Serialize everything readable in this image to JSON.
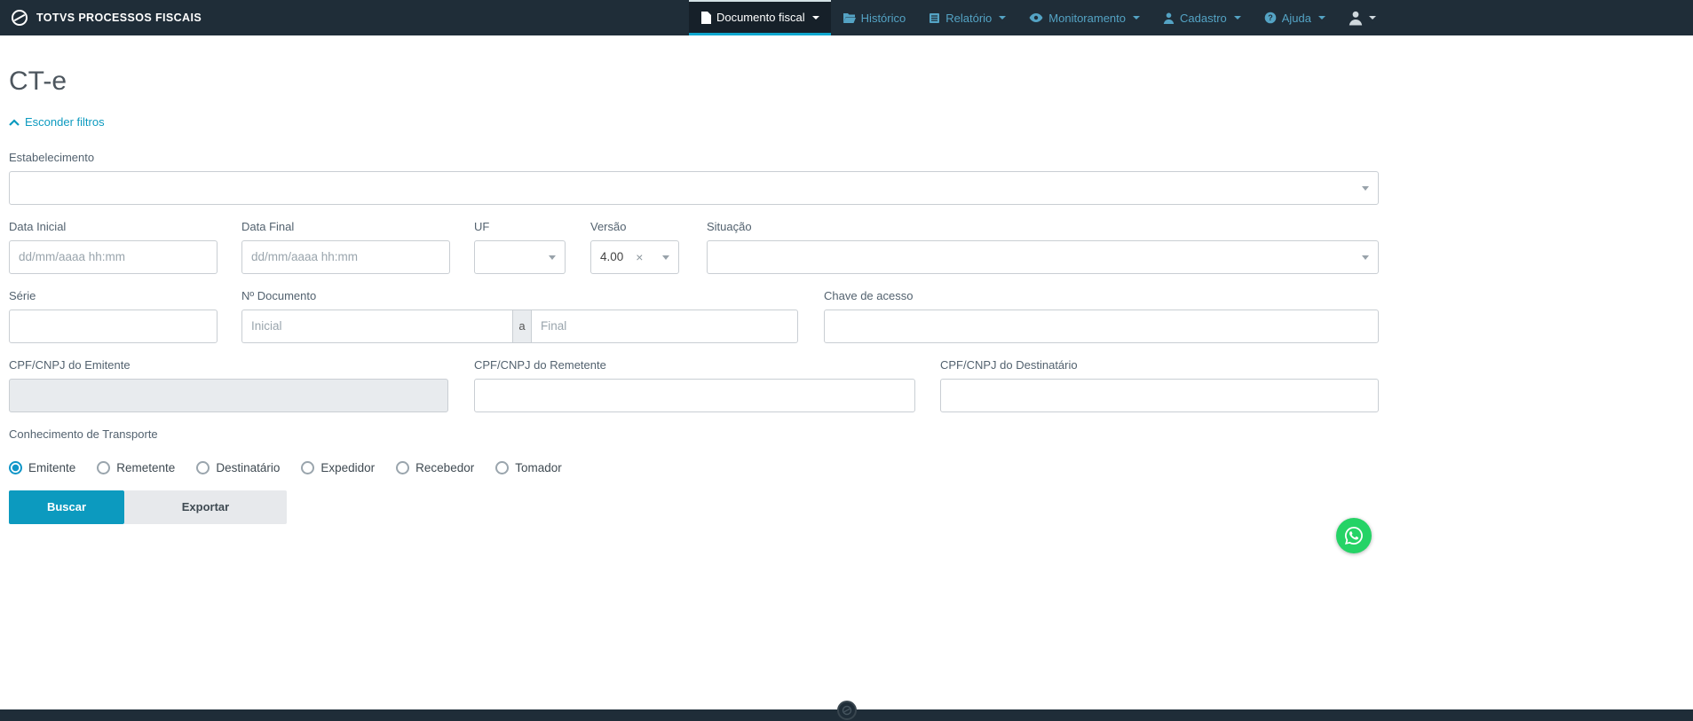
{
  "navbar": {
    "brand": "TOTVS PROCESSOS FISCAIS",
    "items": [
      {
        "label": "Documento fiscal",
        "icon": "document-icon",
        "active": true,
        "has_caret": true
      },
      {
        "label": "Histórico",
        "icon": "history-folder-icon",
        "active": false,
        "has_caret": false
      },
      {
        "label": "Relatório",
        "icon": "report-icon",
        "active": false,
        "has_caret": true
      },
      {
        "label": "Monitoramento",
        "icon": "monitor-eye-icon",
        "active": false,
        "has_caret": true
      },
      {
        "label": "Cadastro",
        "icon": "cadastro-user-icon",
        "active": false,
        "has_caret": true
      },
      {
        "label": "Ajuda",
        "icon": "help-icon",
        "active": false,
        "has_caret": true
      }
    ],
    "account_icon": "account-icon"
  },
  "page": {
    "title": "CT-e",
    "hide_filters_label": "Esconder filtros"
  },
  "filters": {
    "estabelecimento": {
      "label": "Estabelecimento",
      "value": ""
    },
    "data_inicial": {
      "label": "Data Inicial",
      "placeholder": "dd/mm/aaaa hh:mm",
      "value": ""
    },
    "data_final": {
      "label": "Data Final",
      "placeholder": "dd/mm/aaaa hh:mm",
      "value": ""
    },
    "uf": {
      "label": "UF",
      "value": ""
    },
    "versao": {
      "label": "Versão",
      "value": "4.00",
      "clear_symbol": "×"
    },
    "situacao": {
      "label": "Situação",
      "value": ""
    },
    "serie": {
      "label": "Série",
      "value": ""
    },
    "documento": {
      "label": "Nº Documento",
      "inicial_placeholder": "Inicial",
      "connector": "a",
      "final_placeholder": "Final",
      "value_inicial": "",
      "value_final": ""
    },
    "chave": {
      "label": "Chave de acesso",
      "value": ""
    },
    "cpf_emitente": {
      "label": "CPF/CNPJ do Emitente",
      "value": "",
      "disabled": true
    },
    "cpf_remetente": {
      "label": "CPF/CNPJ do Remetente",
      "value": ""
    },
    "cpf_destinatario": {
      "label": "CPF/CNPJ do Destinatário",
      "value": ""
    },
    "conhecimento": {
      "label": "Conhecimento de Transporte",
      "options": [
        "Emitente",
        "Remetente",
        "Destinatário",
        "Expedidor",
        "Recebedor",
        "Tomador"
      ],
      "selected": "Emitente"
    }
  },
  "actions": {
    "buscar": "Buscar",
    "exportar": "Exportar"
  },
  "colors": {
    "accent": "#0c9abf",
    "navbar_bg": "#1f2d38",
    "nav_link": "#54a3c4",
    "whatsapp_green": "#25d366"
  }
}
